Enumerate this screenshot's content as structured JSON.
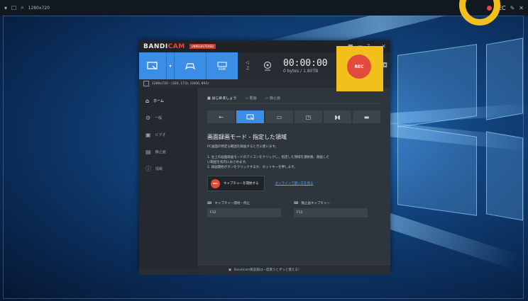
{
  "capture_bar": {
    "size_label": "1280x720",
    "rec_label": "REC"
  },
  "app": {
    "brand_prefix": "BANDI",
    "brand_suffix": "CAM",
    "reg_badge": "UNREGISTERED",
    "timer": "00:00:00",
    "bytes": "0 bytes / 1.80TB",
    "rec_button": "REC",
    "hdmi_label": "HDMI",
    "range_text": "1280x720 - (320, 173), (1600, 893)"
  },
  "sidebar": {
    "items": [
      {
        "label": "ホーム"
      },
      {
        "label": "一般"
      },
      {
        "label": "ビデオ"
      },
      {
        "label": "静止画"
      },
      {
        "label": "情報"
      }
    ]
  },
  "tabs": [
    {
      "label": "はじめましょう"
    },
    {
      "label": "動画"
    },
    {
      "label": "静止画"
    }
  ],
  "content": {
    "title": "画面録画モード - 指定した領域",
    "subtitle": "PC画面の特定な範囲を録画するときに使います。",
    "step1": "1. 左上の画面録画モードのアイコンをクリックし、指定した領域を選択後、録画した",
    "step1b": "い範囲を枠内におさめます。",
    "step2": "2. 録画開始ボタンをクリックするか、ホットキーを押します。",
    "capture_button": "キャプチャーを開始する",
    "mini_rec": "REC",
    "online_link": "オンラインで使い方を見る",
    "hotkey1_label": "キャプチャー開始・停止",
    "hotkey1_value": "F12",
    "hotkey2_label": "静止画キャプチャー",
    "hotkey2_value": "F11"
  },
  "footer": {
    "text": "Bandicam製品版は一度買うとずっと使える！"
  },
  "colors": {
    "accent": "#3a8ee6",
    "rec": "#e24b3b",
    "highlight": "#f2c01a"
  }
}
